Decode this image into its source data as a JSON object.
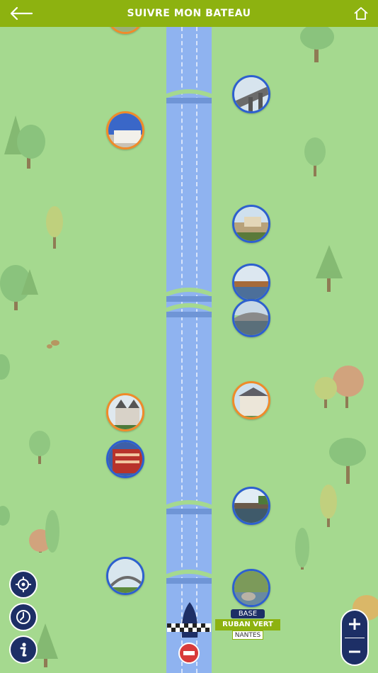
{
  "header": {
    "title": "SUIVRE MON BATEAU",
    "back_icon": "back-arrow-icon",
    "home_icon": "home-icon"
  },
  "base_marker": {
    "label": "BASE",
    "name": "RUBAN VERT",
    "city": "NANTES"
  },
  "controls": {
    "locate_icon": "crosshair-icon",
    "history_icon": "clock-icon",
    "info_icon": "info-icon",
    "zoom_in_icon": "plus-icon",
    "zoom_out_icon": "minus-icon"
  },
  "colors": {
    "header": "#8db210",
    "map_background": "#a5d98f",
    "river": "#8fb3f0",
    "control": "#1d2f66",
    "poi_blue_border": "#2d5fd0",
    "poi_orange_border": "#f08a2a"
  }
}
